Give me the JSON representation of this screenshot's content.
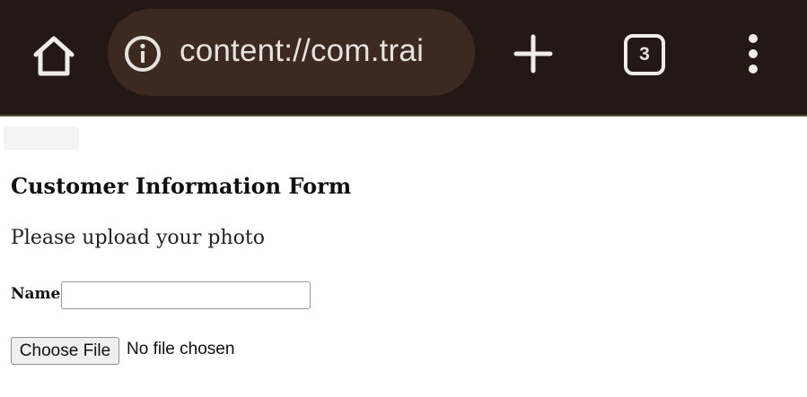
{
  "browser": {
    "url": "content://com.trai",
    "tab_count": "3",
    "toolbar_color": "#231813",
    "icons": {
      "home": "home-icon",
      "site_info": "info-icon",
      "new_tab": "plus-icon",
      "tab_switcher": "tab-switcher-icon",
      "menu": "more-vert-icon"
    }
  },
  "form": {
    "title": "Customer Information Form",
    "description": "Please upload your photo",
    "name_label": "Name",
    "name_value": "",
    "file_button_label": "Choose File",
    "file_status": "No file chosen"
  }
}
